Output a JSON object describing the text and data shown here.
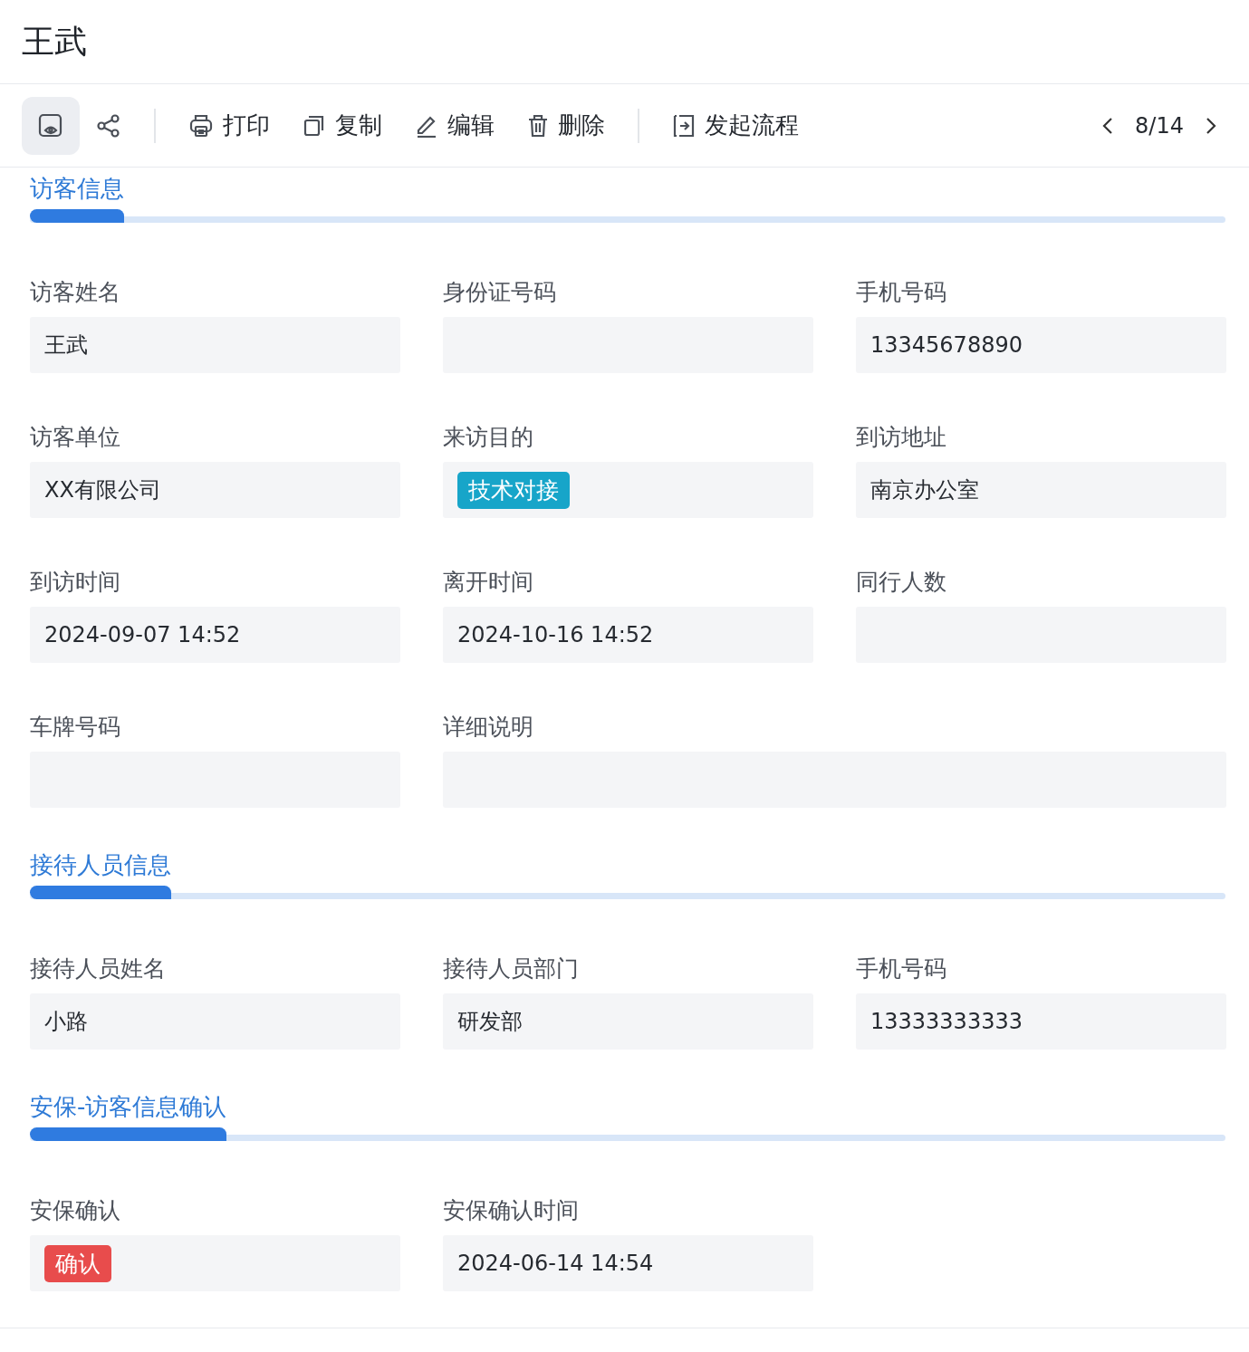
{
  "title": "王武",
  "toolbar": {
    "view_buttons": [
      {
        "kind": "preview",
        "selected": true
      },
      {
        "kind": "share",
        "selected": false
      }
    ],
    "actions": [
      {
        "kind": "print",
        "label": "打印"
      },
      {
        "kind": "copy",
        "label": "复制"
      },
      {
        "kind": "edit",
        "label": "编辑"
      },
      {
        "kind": "delete",
        "label": "删除"
      },
      {
        "kind": "flow",
        "label": "发起流程"
      }
    ],
    "pager": "8/14"
  },
  "sections": [
    {
      "title": "访客信息",
      "fields": [
        {
          "label": "访客姓名",
          "kind": "text",
          "value": "王武"
        },
        {
          "label": "身份证号码",
          "kind": "text"
        },
        {
          "label": "手机号码",
          "kind": "text",
          "value": "13345678890"
        },
        {
          "label": "访客单位",
          "kind": "text",
          "value": "XX有限公司"
        },
        {
          "label": "来访目的",
          "kind": "tag",
          "value": "技术对接",
          "color": "#17a5c9"
        },
        {
          "label": "到访地址",
          "kind": "text",
          "value": "南京办公室"
        },
        {
          "label": "到访时间",
          "kind": "text",
          "value": "2024-09-07 14:52"
        },
        {
          "label": "离开时间",
          "kind": "text",
          "value": "2024-10-16 14:52"
        },
        {
          "label": "同行人数",
          "kind": "text"
        },
        {
          "label": "车牌号码",
          "kind": "text"
        },
        {
          "label": "详细说明",
          "kind": "text",
          "wide": true
        }
      ]
    },
    {
      "title": "接待人员信息",
      "fields": [
        {
          "label": "接待人员姓名",
          "kind": "text",
          "value": "小路"
        },
        {
          "label": "接待人员部门",
          "kind": "text",
          "value": "研发部"
        },
        {
          "label": "手机号码",
          "kind": "text",
          "value": "13333333333"
        }
      ]
    },
    {
      "title": "安保-访客信息确认",
      "fields": [
        {
          "label": "安保确认",
          "kind": "tag",
          "value": "确认",
          "color": "#e84c4c"
        },
        {
          "label": "安保确认时间",
          "kind": "text",
          "value": "2024-06-14 14:54"
        }
      ]
    }
  ]
}
